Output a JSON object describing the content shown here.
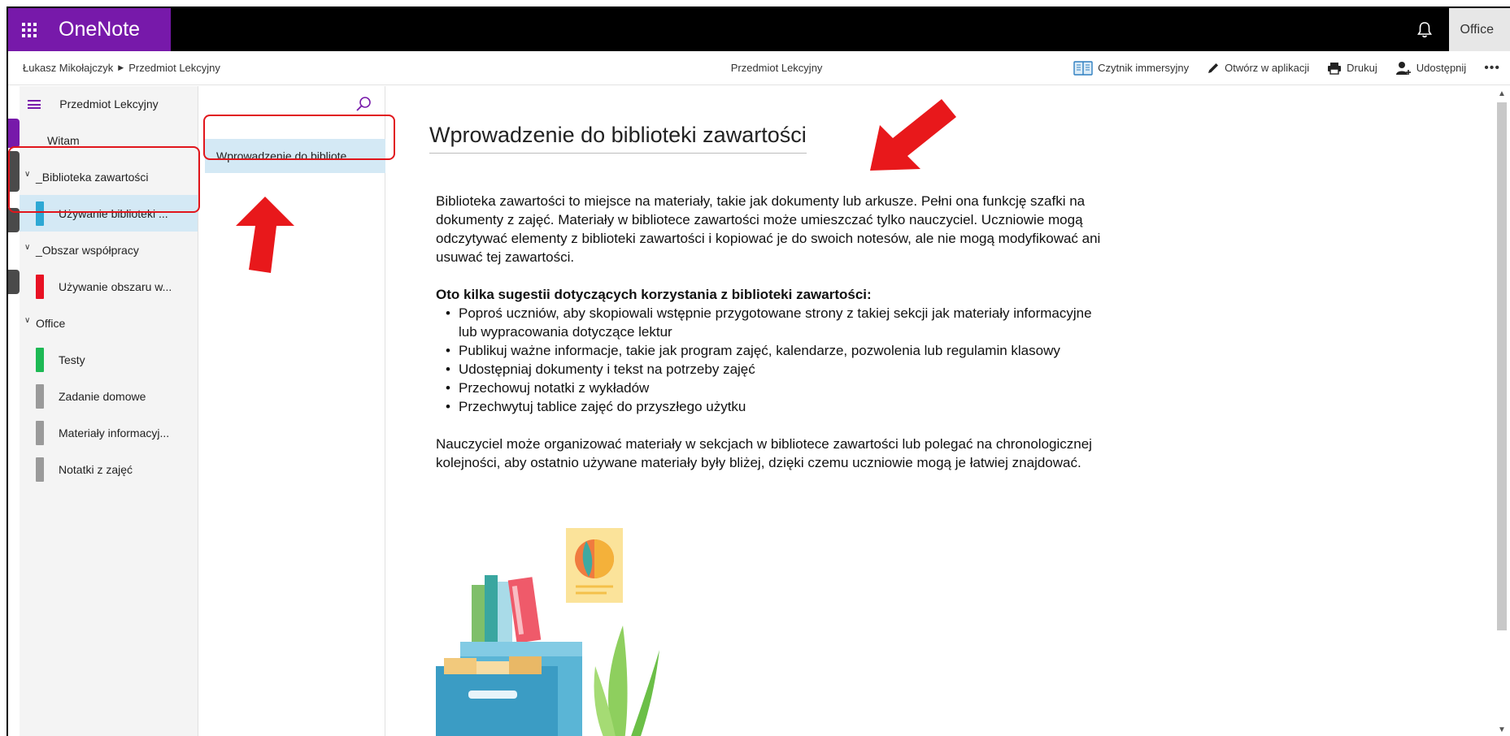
{
  "app": {
    "brand": "OneNote",
    "office_label": "Office"
  },
  "cmdbar": {
    "breadcrumb_user": "Łukasz Mikołajczyk",
    "breadcrumb_notebook": "Przedmiot Lekcyjny",
    "title": "Przedmiot Lekcyjny",
    "immersive_reader": "Czytnik immersyjny",
    "open_in_app": "Otwórz w aplikacji",
    "print": "Drukuj",
    "share": "Udostępnij",
    "more": "•••"
  },
  "sections": {
    "title": "Przedmiot Lekcyjny",
    "items": [
      {
        "label": "Witam",
        "color": "#7719aa",
        "kind": "section"
      },
      {
        "label": "_Biblioteka zawartości",
        "kind": "group"
      },
      {
        "label": "Używanie biblioteki ...",
        "color": "#2ea8d4",
        "kind": "sub",
        "selected": true
      },
      {
        "label": "_Obszar współpracy",
        "kind": "group"
      },
      {
        "label": "Używanie obszaru w...",
        "color": "#e81123",
        "kind": "sub"
      },
      {
        "label": "Office",
        "kind": "group"
      },
      {
        "label": "Testy",
        "color": "#1db954",
        "kind": "sub"
      },
      {
        "label": "Zadanie domowe",
        "color": "#9a9a9a",
        "kind": "sub"
      },
      {
        "label": "Materiały informacyj...",
        "color": "#9a9a9a",
        "kind": "sub"
      },
      {
        "label": "Notatki z zajęć",
        "color": "#9a9a9a",
        "kind": "sub"
      }
    ]
  },
  "pages": {
    "items": [
      {
        "label": "Wprowadzenie do bibliote...",
        "selected": true
      }
    ]
  },
  "page": {
    "title": "Wprowadzenie do biblioteki zawartości",
    "para1": "Biblioteka zawartości to miejsce na materiały, takie jak dokumenty lub arkusze. Pełni ona funkcję szafki na dokumenty z zajęć. Materiały w bibliotece zawartości może umieszczać tylko nauczyciel. Uczniowie mogą odczytywać elementy z biblioteki zawartości i kopiować je do swoich notesów, ale nie mogą modyfikować ani usuwać tej zawartości.",
    "heading": "Oto kilka sugestii dotyczących korzystania z biblioteki zawartości:",
    "bullets": [
      "Poproś uczniów, aby skopiowali wstępnie przygotowane strony z takiej sekcji jak materiały informacyjne lub wypracowania dotyczące lektur",
      "Publikuj ważne informacje, takie jak program zajęć, kalendarze, pozwolenia lub regulamin klasowy",
      "Udostępniaj dokumenty i tekst na potrzeby zajęć",
      "Przechowuj notatki z wykładów",
      "Przechwytuj tablice zajęć do przyszłego użytku"
    ],
    "para2": "Nauczyciel może organizować materiały w sekcjach w bibliotece zawartości lub polegać na chronologicznej kolejności, aby ostatnio używane materiały były bliżej, dzięki czemu uczniowie mogą je łatwiej znajdować."
  },
  "colors": {
    "brand_purple": "#7719aa",
    "highlight_red": "#e1161c",
    "selection_blue": "#d4e9f5"
  }
}
